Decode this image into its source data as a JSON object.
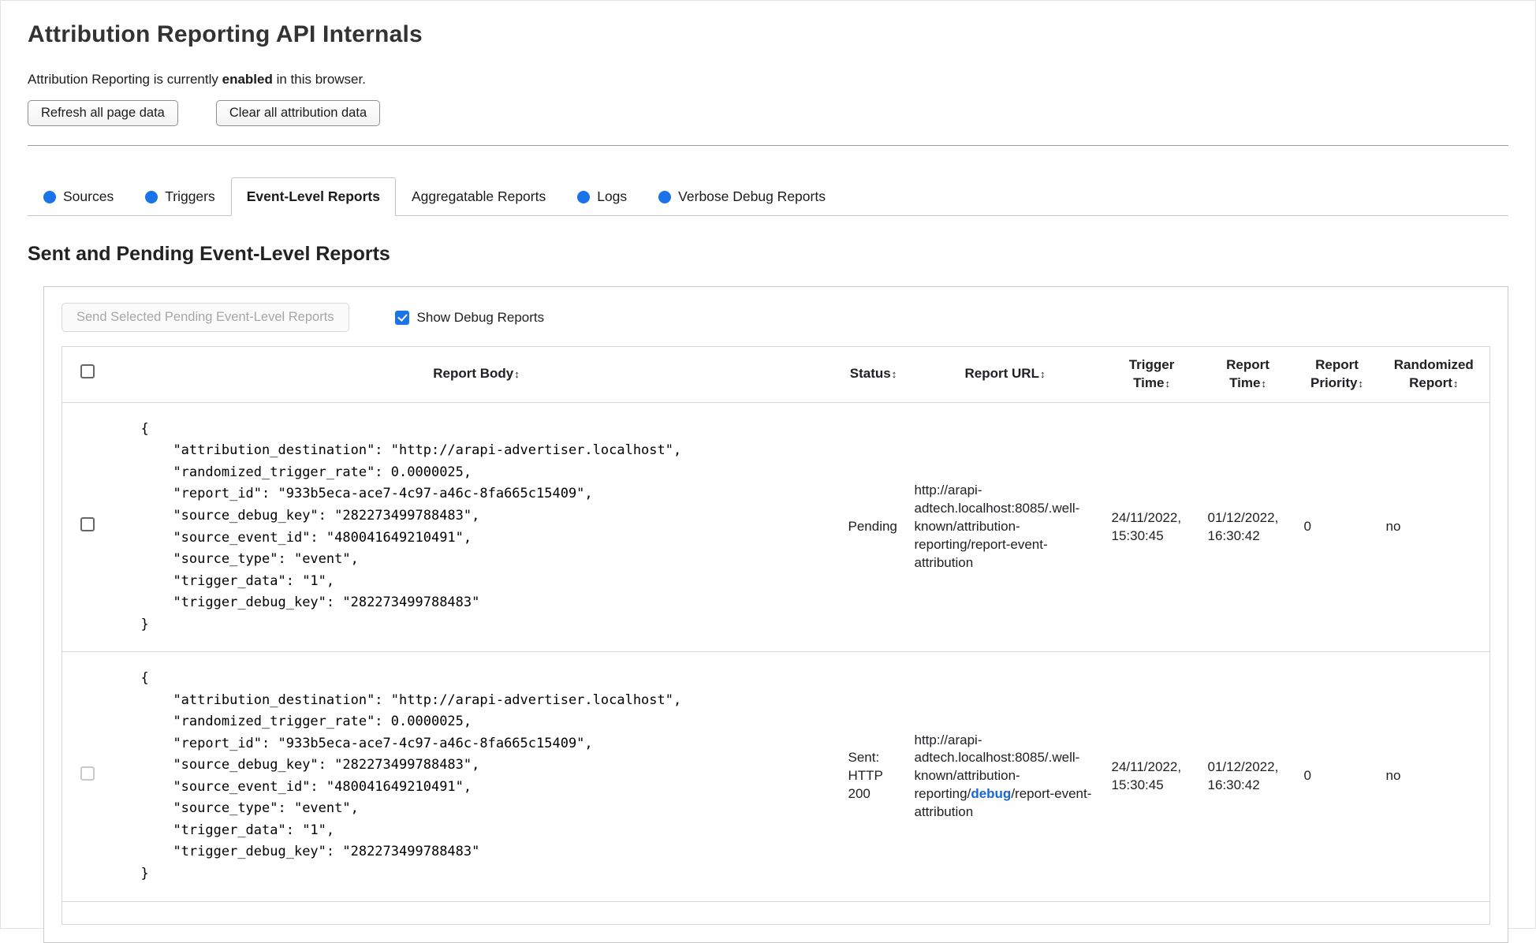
{
  "page": {
    "title": "Attribution Reporting API Internals",
    "status_prefix": "Attribution Reporting is currently ",
    "status_bold": "enabled",
    "status_suffix": " in this browser.",
    "refresh_button": "Refresh all page data",
    "clear_button": "Clear all attribution data"
  },
  "tabs": [
    {
      "label": "Sources"
    },
    {
      "label": "Triggers"
    },
    {
      "label": "Event-Level Reports"
    },
    {
      "label": "Aggregatable Reports"
    },
    {
      "label": "Logs"
    },
    {
      "label": "Verbose Debug Reports"
    }
  ],
  "section": {
    "heading": "Sent and Pending Event-Level Reports",
    "send_button": "Send Selected Pending Event-Level Reports",
    "show_debug_label": "Show Debug Reports"
  },
  "table": {
    "sort_glyph": "↕",
    "headers": {
      "body": "Report Body",
      "status": "Status",
      "url": "Report URL",
      "trigger_time": "Trigger Time",
      "report_time": "Report Time",
      "priority": "Report Priority",
      "randomized": "Randomized Report"
    }
  },
  "rows": [
    {
      "body": "{\n    \"attribution_destination\": \"http://arapi-advertiser.localhost\",\n    \"randomized_trigger_rate\": 0.0000025,\n    \"report_id\": \"933b5eca-ace7-4c97-a46c-8fa665c15409\",\n    \"source_debug_key\": \"282273499788483\",\n    \"source_event_id\": \"480041649210491\",\n    \"source_type\": \"event\",\n    \"trigger_data\": \"1\",\n    \"trigger_debug_key\": \"282273499788483\"\n}",
      "status": "Pending",
      "url_prefix": "http://arapi-adtech.localhost:8085/.well-known/attribution-reporting/report-event-attribution",
      "url_link": "",
      "url_suffix": "",
      "trigger_time": "24/11/2022, 15:30:45",
      "report_time": "01/12/2022, 16:30:42",
      "priority": "0",
      "randomized": "no"
    },
    {
      "body": "{\n    \"attribution_destination\": \"http://arapi-advertiser.localhost\",\n    \"randomized_trigger_rate\": 0.0000025,\n    \"report_id\": \"933b5eca-ace7-4c97-a46c-8fa665c15409\",\n    \"source_debug_key\": \"282273499788483\",\n    \"source_event_id\": \"480041649210491\",\n    \"source_type\": \"event\",\n    \"trigger_data\": \"1\",\n    \"trigger_debug_key\": \"282273499788483\"\n}",
      "status": "Sent: HTTP 200",
      "url_prefix": "http://arapi-adtech.localhost:8085/.well-known/attribution-reporting/",
      "url_link": "debug",
      "url_suffix": "/report-event-attribution",
      "trigger_time": "24/11/2022, 15:30:45",
      "report_time": "01/12/2022, 16:30:42",
      "priority": "0",
      "randomized": "no"
    }
  ]
}
